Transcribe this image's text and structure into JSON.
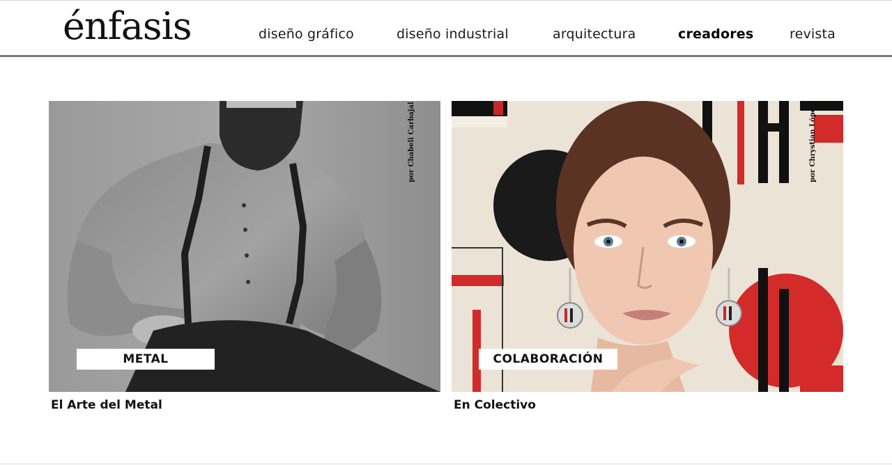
{
  "header": {
    "logo_text": "énfasis",
    "nav": [
      {
        "label": "diseño gráfico",
        "active": false
      },
      {
        "label": "diseño industrial",
        "active": false
      },
      {
        "label": "arquitectura",
        "active": false
      },
      {
        "label": "creadores",
        "active": true
      },
      {
        "label": "revista",
        "active": false
      }
    ]
  },
  "cards": [
    {
      "category": "METAL",
      "title": "El Arte del Metal",
      "byline": "por Chabeli Carbajal",
      "image_subject": "bearded man in grey shirt with suspenders"
    },
    {
      "category": "COLABORACIÓN",
      "title": "En Colectivo",
      "byline": "por Chrystian López",
      "image_subject": "woman with earrings over red and black geometric background"
    }
  ],
  "colors": {
    "nav_border": "#7a7a7a",
    "accent_red": "#d32a2a",
    "background": "#ffffff"
  }
}
